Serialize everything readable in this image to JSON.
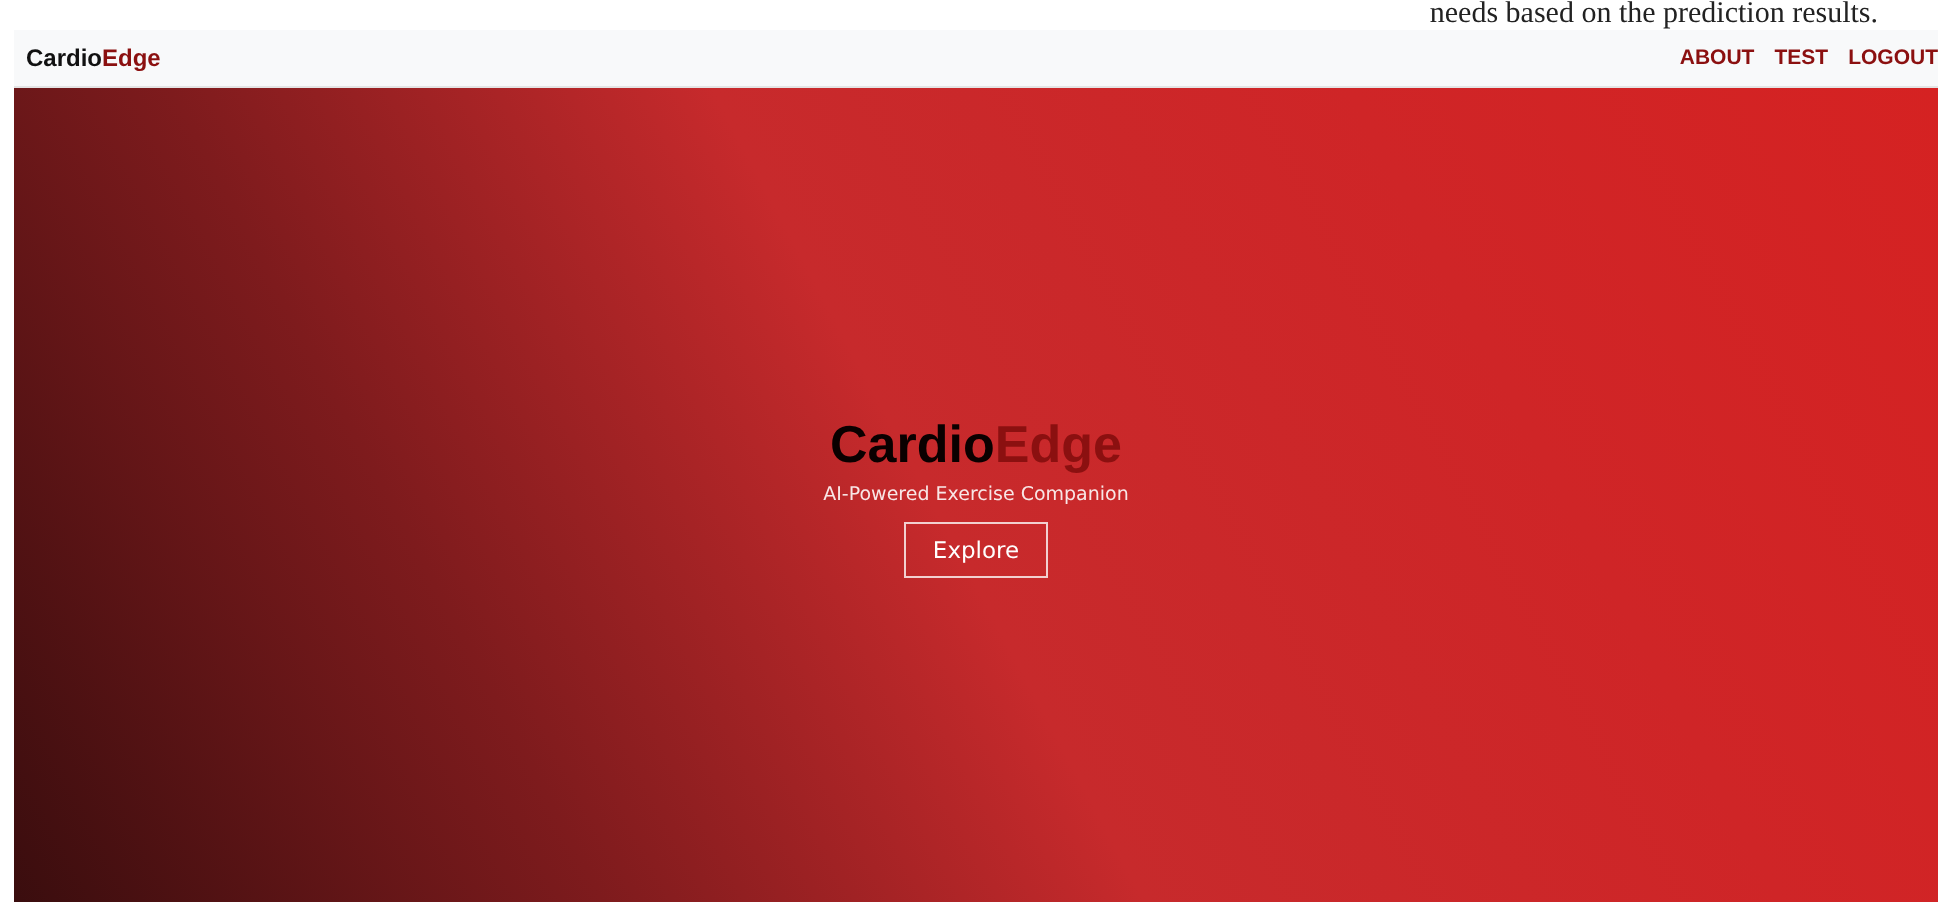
{
  "document_text": "needs based on the prediction results.",
  "navbar": {
    "brand": {
      "first": "Cardio",
      "second": "Edge"
    },
    "links": [
      {
        "label": "ABOUT"
      },
      {
        "label": "TEST"
      },
      {
        "label": "LOGOUT"
      }
    ]
  },
  "hero": {
    "title": {
      "first": "Cardio",
      "second": "Edge"
    },
    "subtitle": "AI-Powered Exercise Companion",
    "button": "Explore"
  }
}
